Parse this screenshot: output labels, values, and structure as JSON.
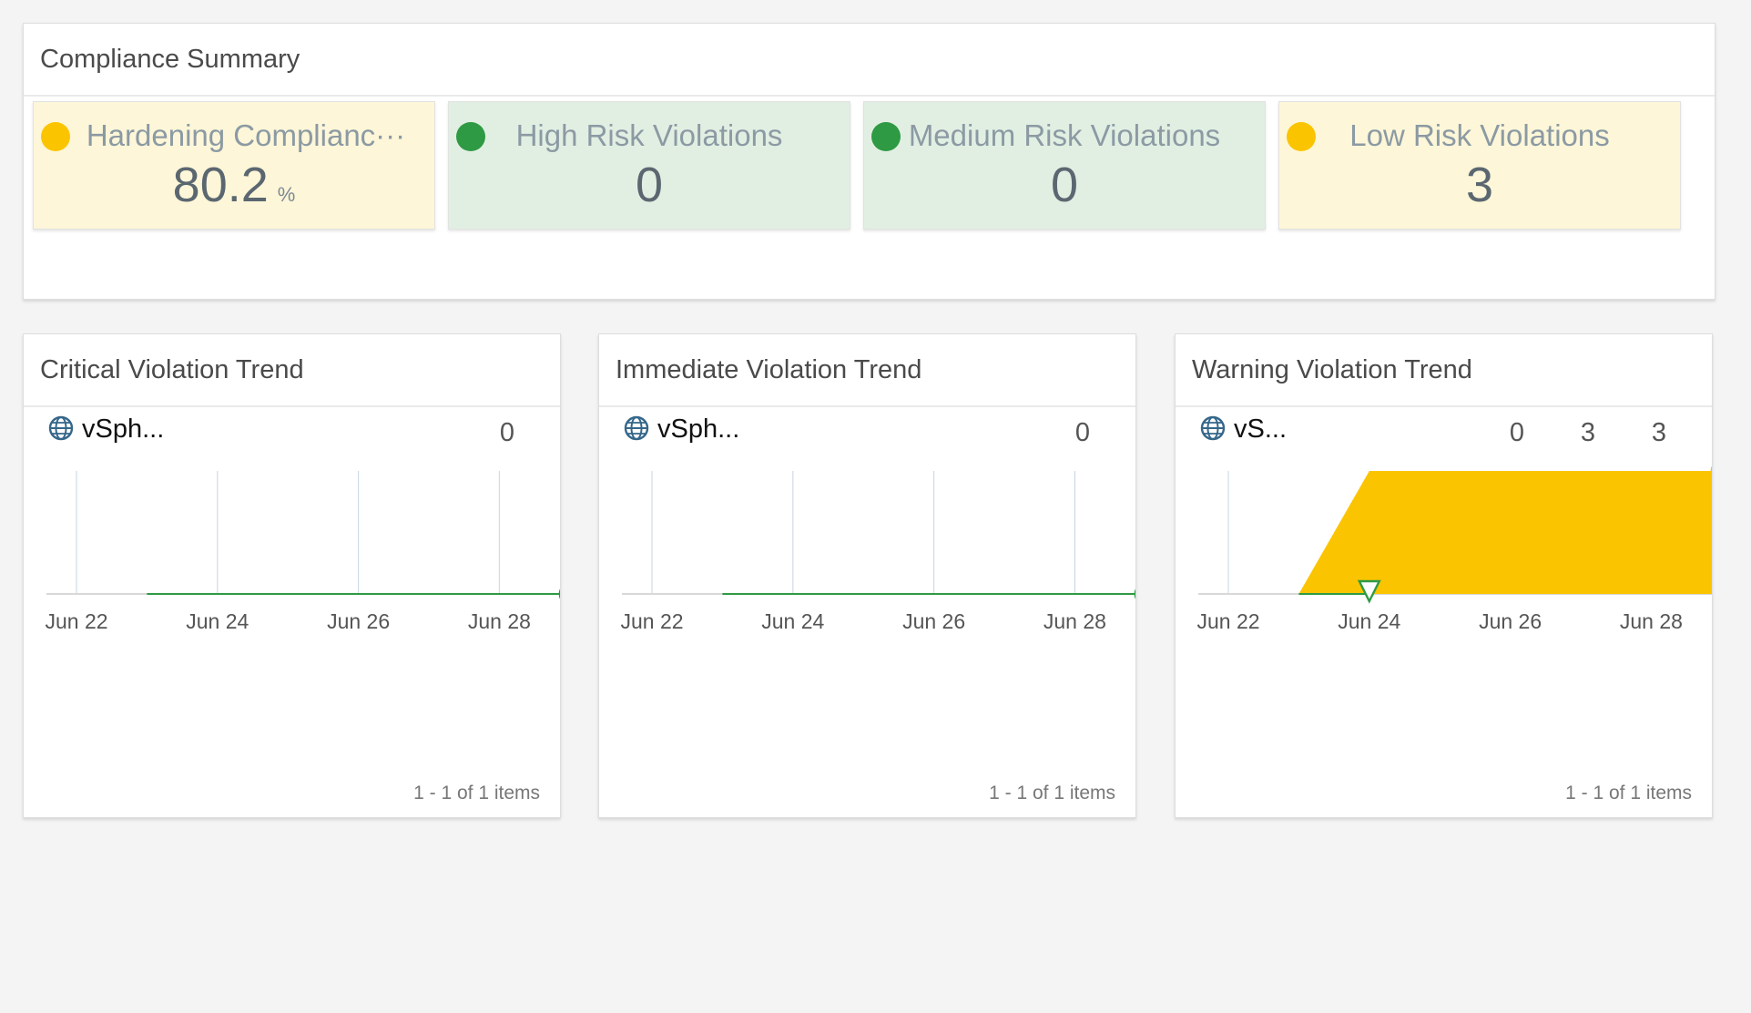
{
  "summary": {
    "title": "Compliance Summary",
    "tiles": [
      {
        "label": "Hardening Complianc···",
        "value": "80.2",
        "unit": "%",
        "status_color": "#fbc400",
        "bg": "#fdf6d8"
      },
      {
        "label": "High Risk Violations",
        "value": "0",
        "status_color": "#2e9a43",
        "bg": "#e1efe3"
      },
      {
        "label": "Medium Risk Violations",
        "value": "0",
        "status_color": "#2e9a43",
        "bg": "#e1efe3"
      },
      {
        "label": "Low Risk Violations",
        "value": "3",
        "status_color": "#fbc400",
        "bg": "#fdf6d8"
      }
    ]
  },
  "trends": [
    {
      "title": "Critical Violation Trend",
      "resource": "vSph...",
      "legend_values": [
        "0"
      ],
      "pager": "1 - 1 of 1 items",
      "icon": "globe-icon"
    },
    {
      "title": "Immediate Violation Trend",
      "resource": "vSph...",
      "legend_values": [
        "0"
      ],
      "pager": "1 - 1 of 1 items",
      "icon": "globe-icon"
    },
    {
      "title": "Warning Violation Trend",
      "resource": "vS...",
      "legend_values": [
        "0",
        "3",
        "3"
      ],
      "pager": "1 - 1 of 1 items",
      "icon": "globe-icon"
    }
  ],
  "chart_data": [
    {
      "type": "area",
      "title": "Critical Violation Trend",
      "x_tick_labels": [
        "Jun 22",
        "Jun 24",
        "Jun 26",
        "Jun 28"
      ],
      "x": [
        "Jun 22",
        "Jun 23",
        "Jun 24",
        "Jun 25",
        "Jun 26",
        "Jun 27",
        "Jun 28",
        "Jun 29"
      ],
      "series": [
        {
          "name": "vSph...",
          "values": [
            null,
            0,
            0,
            0,
            0,
            0,
            0,
            0
          ],
          "color": "#2e9a43"
        }
      ],
      "ylim": [
        0,
        1
      ]
    },
    {
      "type": "area",
      "title": "Immediate Violation Trend",
      "x_tick_labels": [
        "Jun 22",
        "Jun 24",
        "Jun 26",
        "Jun 28"
      ],
      "x": [
        "Jun 22",
        "Jun 23",
        "Jun 24",
        "Jun 25",
        "Jun 26",
        "Jun 27",
        "Jun 28",
        "Jun 29"
      ],
      "series": [
        {
          "name": "vSph...",
          "values": [
            null,
            0,
            0,
            0,
            0,
            0,
            0,
            0
          ],
          "color": "#2e9a43"
        }
      ],
      "ylim": [
        0,
        1
      ]
    },
    {
      "type": "area",
      "title": "Warning Violation Trend",
      "x_tick_labels": [
        "Jun 22",
        "Jun 24",
        "Jun 26",
        "Jun 28"
      ],
      "x": [
        "Jun 22",
        "Jun 23",
        "Jun 24",
        "Jun 25",
        "Jun 26",
        "Jun 27",
        "Jun 28",
        "Jun 29"
      ],
      "series": [
        {
          "name": "vS...",
          "values": [
            null,
            0,
            3,
            3,
            3,
            3,
            3,
            3
          ],
          "color": "#fbc400"
        }
      ],
      "ylim": [
        0,
        3
      ]
    }
  ]
}
